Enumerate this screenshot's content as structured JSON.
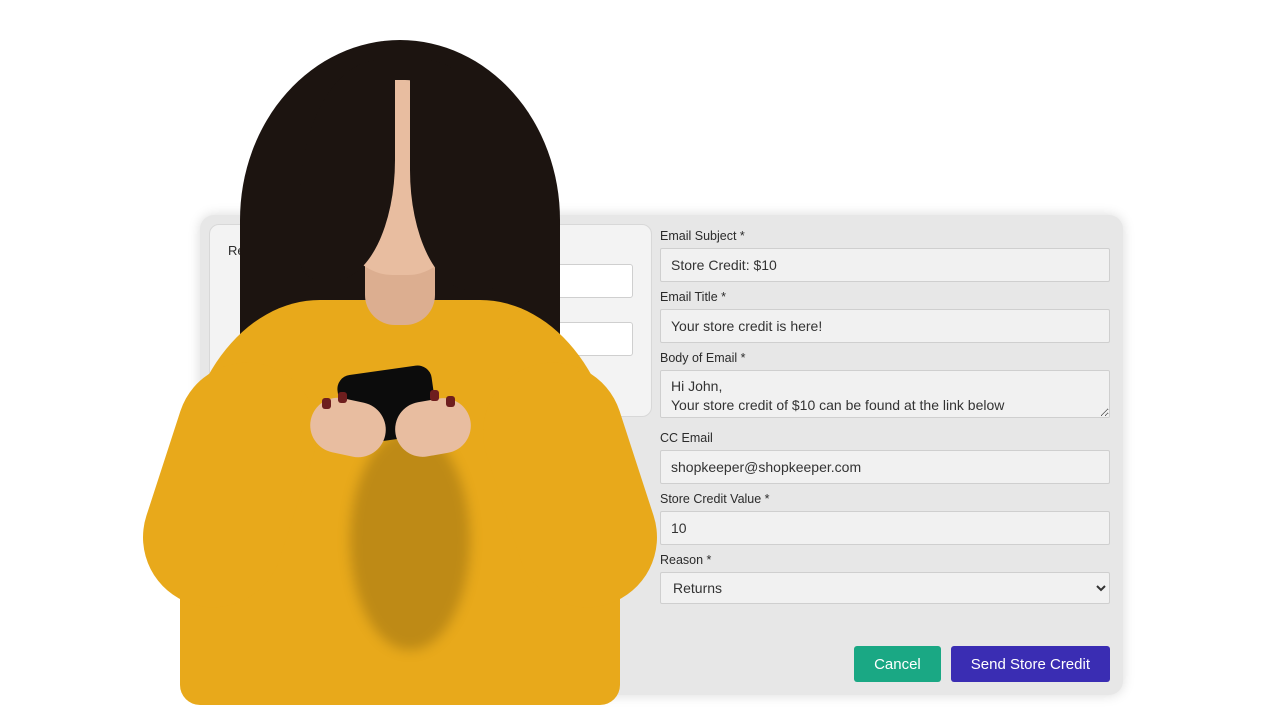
{
  "left": {
    "recipient_label": "Recipient Name",
    "recipient_value": "",
    "second_value": ""
  },
  "form": {
    "email_subject_label": "Email Subject *",
    "email_subject_value": "Store Credit: $10",
    "email_title_label": "Email Title *",
    "email_title_value": "Your store credit is here!",
    "body_label": "Body of Email *",
    "body_value": "Hi John,\nYour store credit of $10 can be found at the link below",
    "cc_label": "CC Email",
    "cc_value": "shopkeeper@shopkeeper.com",
    "value_label": "Store Credit Value *",
    "value_value": "10",
    "reason_label": "Reason *",
    "reason_selected": "Returns"
  },
  "buttons": {
    "cancel": "Cancel",
    "send": "Send Store Credit"
  }
}
